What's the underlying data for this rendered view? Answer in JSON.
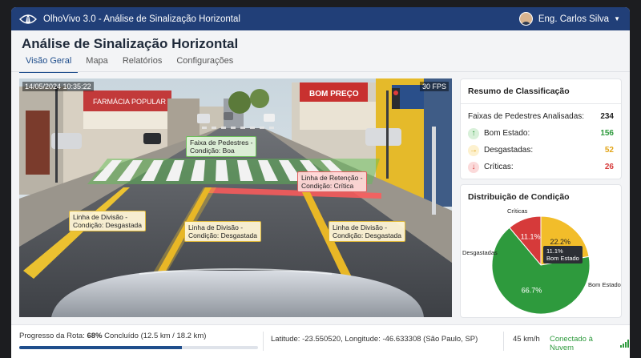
{
  "app": {
    "window_title": "OlhoVivo 3.0 - Análise de Sinalização Horizontal",
    "user_name": "Eng. Carlos Silva",
    "logo_icon": "road-eye-icon"
  },
  "page": {
    "title": "Análise de Sinalização Horizontal",
    "tabs": [
      {
        "label": "Visão Geral",
        "active": true
      },
      {
        "label": "Mapa",
        "active": false
      },
      {
        "label": "Relatórios",
        "active": false
      },
      {
        "label": "Configurações",
        "active": false
      }
    ]
  },
  "video": {
    "timestamp": "14/05/2024 10:35:22",
    "fps": "30 FPS",
    "storefront_signs": [
      "FARMÁCIA POPULAR",
      "BOM PREÇO"
    ],
    "detections": [
      {
        "line1": "Faixa de Pedestres -",
        "line2": "Condição: Boa",
        "status": "good"
      },
      {
        "line1": "Linha de Retenção -",
        "line2": "Condição: Crítica",
        "status": "critical"
      },
      {
        "line1": "Linha de Divisão -",
        "line2": "Condição: Desgastada",
        "status": "worn"
      },
      {
        "line1": "Linha de Divisão -",
        "line2": "Condição: Desgastada",
        "status": "worn"
      },
      {
        "line1": "Linha de Divisão -",
        "line2": "Condição: Desgastada",
        "status": "worn"
      }
    ]
  },
  "summary": {
    "title": "Resumo de Classificação",
    "total_label": "Faixas de Pedestres Analisadas:",
    "total_value": "234",
    "rows": [
      {
        "label": "Bom Estado:",
        "value": "156",
        "icon": "arrow-up-icon",
        "color": "#2e9a3d"
      },
      {
        "label": "Desgastadas:",
        "value": "52",
        "icon": "arrow-right-icon",
        "color": "#e2a417"
      },
      {
        "label": "Críticas:",
        "value": "26",
        "icon": "arrow-down-icon",
        "color": "#d63a3a"
      }
    ]
  },
  "distribution": {
    "title": "Distribuição de Condição",
    "tooltip": {
      "line1": "11.1%",
      "line2": "Bom Estado"
    }
  },
  "chart_data": {
    "type": "pie",
    "slices": [
      {
        "name": "Bom Estado",
        "value": 66.7,
        "label": "66.7%",
        "color": "#2e9a3d"
      },
      {
        "name": "Desgastadas",
        "value": 22.2,
        "label": "22.2%",
        "color": "#f2bd2a"
      },
      {
        "name": "Críticas",
        "value": 11.1,
        "label": "11.1%",
        "color": "#d63a3a"
      }
    ]
  },
  "status": {
    "progress_prefix": "Progresso da Rota:",
    "progress_pct": "68%",
    "progress_rest": "Concluído (12.5 km / 18.2 km)",
    "progress_value": 68,
    "coords": "Latitude: -23.550520, Longitude: -46.633308 (São Paulo, SP)",
    "speed": "45 km/h",
    "connection": "Conectado à Nuvem"
  }
}
